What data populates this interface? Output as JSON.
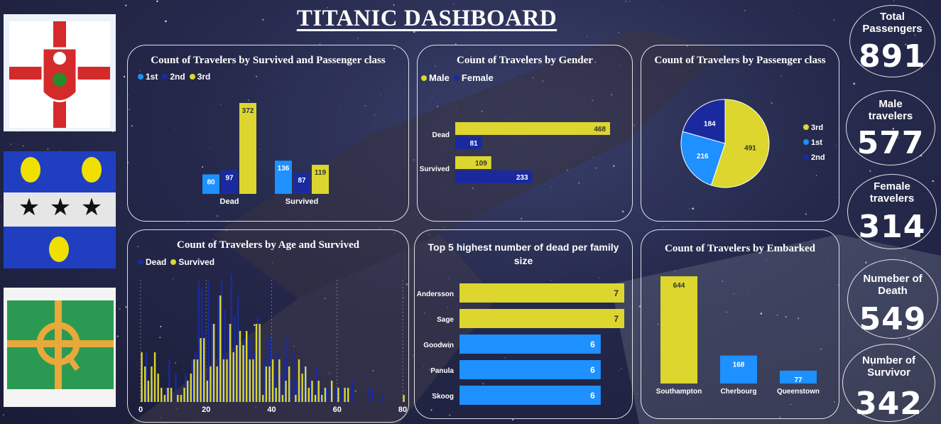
{
  "header": {
    "title": "TITANIC DASHBOARD"
  },
  "colors": {
    "yellow": "#dcd62e",
    "blue": "#1e90ff",
    "navy": "#1a2a9e"
  },
  "flags": [
    {
      "name": "southampton-flag"
    },
    {
      "name": "cherbourg-flag"
    },
    {
      "name": "queenstown-flag"
    }
  ],
  "kpis": [
    {
      "label": "Total Passengers",
      "value": "891"
    },
    {
      "label": "Male travelers",
      "value": "577"
    },
    {
      "label": "Female travelers",
      "value": "314"
    },
    {
      "label": "Numeber of Death",
      "value": "549"
    },
    {
      "label": "Number of Survivor",
      "value": "342"
    }
  ],
  "panels": {
    "survived_class": {
      "title": "Count of Travelers by Survived and Passenger class"
    },
    "gender": {
      "title": "Count of Travelers by Gender"
    },
    "pclass": {
      "title": "Count of Travelers by Passenger class"
    },
    "age": {
      "title": "Count of Travelers by Age and Survived"
    },
    "family": {
      "title": "Top 5 highest number of dead per family size"
    },
    "embarked": {
      "title": "Count of Travelers by Embarked"
    }
  },
  "chart_data": [
    {
      "id": "survived_class",
      "type": "bar",
      "categories": [
        "Dead",
        "Survived"
      ],
      "series": [
        {
          "name": "1st",
          "values": [
            80,
            136
          ],
          "color": "#1e90ff"
        },
        {
          "name": "2nd",
          "values": [
            97,
            87
          ],
          "color": "#1a2a9e"
        },
        {
          "name": "3rd",
          "values": [
            372,
            119
          ],
          "color": "#dcd62e"
        }
      ],
      "legend": "top-left"
    },
    {
      "id": "gender",
      "type": "bar",
      "orientation": "horizontal",
      "categories": [
        "Dead",
        "Survived"
      ],
      "series": [
        {
          "name": "Male",
          "values": [
            468,
            109
          ],
          "color": "#dcd62e"
        },
        {
          "name": "Female",
          "values": [
            81,
            233
          ],
          "color": "#1a2a9e"
        }
      ],
      "legend": "top-left"
    },
    {
      "id": "pclass",
      "type": "pie",
      "labels": [
        "3rd",
        "1st",
        "2nd"
      ],
      "values": [
        491,
        216,
        184
      ],
      "colors": [
        "#dcd62e",
        "#1e90ff",
        "#1a2a9e"
      ],
      "legend": "right"
    },
    {
      "id": "age",
      "type": "bar",
      "x_ticks": [
        "0",
        "20",
        "40",
        "60",
        "80"
      ],
      "xlim": [
        0,
        80
      ],
      "series": [
        {
          "name": "Dead",
          "color": "#1a2a9e",
          "x": [
            1,
            2,
            3,
            4,
            8,
            9,
            11,
            14,
            15,
            16,
            17,
            18,
            19,
            20,
            21,
            22,
            23,
            24,
            25,
            26,
            27,
            28,
            29,
            30,
            31,
            32,
            33,
            34,
            35,
            36,
            37,
            38,
            39,
            40,
            41,
            42,
            43,
            44,
            45,
            46,
            47,
            48,
            49,
            50,
            51,
            52,
            54,
            55,
            56,
            57,
            58,
            59,
            60,
            61,
            62,
            64,
            65,
            70,
            71,
            74
          ],
          "values": [
            2,
            7,
            1,
            3,
            2,
            6,
            4,
            4,
            3,
            6,
            7,
            17,
            16,
            10,
            17,
            11,
            11,
            15,
            17,
            13,
            11,
            18,
            12,
            15,
            8,
            9,
            9,
            9,
            7,
            12,
            5,
            6,
            9,
            9,
            4,
            7,
            4,
            6,
            9,
            3,
            7,
            3,
            2,
            5,
            5,
            3,
            5,
            1,
            2,
            2,
            2,
            2,
            2,
            2,
            2,
            2,
            3,
            2,
            2,
            1
          ]
        },
        {
          "name": "Survived",
          "color": "#dcd62e",
          "x": [
            0,
            1,
            2,
            3,
            4,
            5,
            6,
            7,
            8,
            9,
            11,
            12,
            13,
            14,
            15,
            16,
            17,
            18,
            19,
            20,
            21,
            22,
            23,
            24,
            25,
            26,
            27,
            28,
            29,
            30,
            31,
            32,
            33,
            34,
            35,
            36,
            37,
            38,
            39,
            40,
            41,
            42,
            43,
            44,
            45,
            47,
            48,
            49,
            50,
            51,
            52,
            53,
            54,
            55,
            56,
            58,
            60,
            62,
            63,
            80
          ],
          "values": [
            7,
            5,
            3,
            5,
            7,
            4,
            2,
            1,
            2,
            2,
            1,
            1,
            2,
            3,
            4,
            6,
            6,
            9,
            9,
            3,
            5,
            11,
            5,
            15,
            6,
            6,
            11,
            7,
            8,
            10,
            8,
            10,
            6,
            6,
            11,
            11,
            1,
            5,
            5,
            6,
            2,
            6,
            1,
            3,
            5,
            1,
            6,
            4,
            5,
            2,
            3,
            1,
            3,
            1,
            2,
            3,
            2,
            2,
            2,
            1
          ]
        }
      ],
      "legend": "top-left"
    },
    {
      "id": "family",
      "type": "bar",
      "orientation": "horizontal",
      "categories": [
        "Andersson",
        "Sage",
        "Goodwin",
        "Panula",
        "Skoog"
      ],
      "values": [
        7,
        7,
        6,
        6,
        6
      ],
      "colors": [
        "#dcd62e",
        "#dcd62e",
        "#1e90ff",
        "#1e90ff",
        "#1e90ff"
      ]
    },
    {
      "id": "embarked",
      "type": "bar",
      "categories": [
        "Southampton",
        "Cherbourg",
        "Queenstown"
      ],
      "values": [
        644,
        168,
        77
      ],
      "colors": [
        "#dcd62e",
        "#1e90ff",
        "#1e90ff"
      ]
    }
  ]
}
